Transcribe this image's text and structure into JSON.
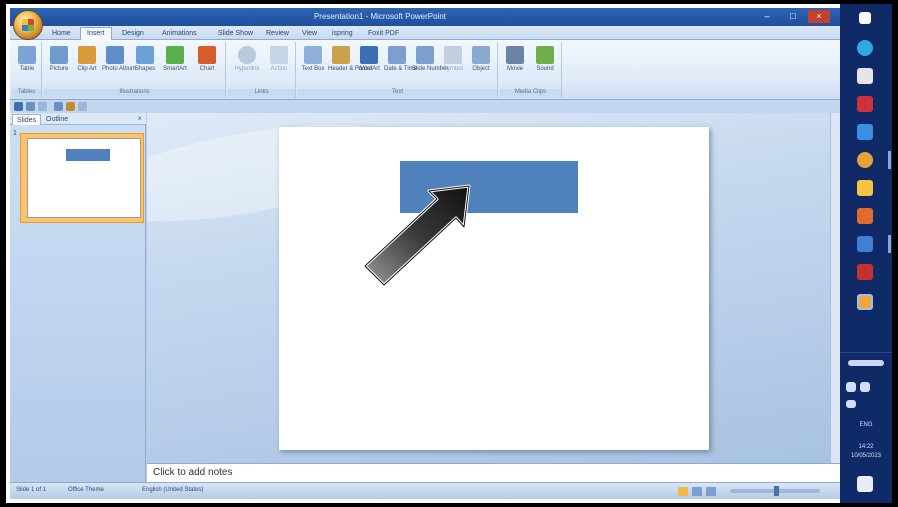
{
  "window": {
    "title": "Presentation1 - Microsoft PowerPoint",
    "minimize": "–",
    "maximize": "□",
    "close": "×"
  },
  "ribbon_tabs": [
    {
      "label": "Home"
    },
    {
      "label": "Insert",
      "active": true
    },
    {
      "label": "Design"
    },
    {
      "label": "Animations"
    },
    {
      "label": "Slide Show"
    },
    {
      "label": "Review"
    },
    {
      "label": "View"
    },
    {
      "label": "ispring"
    },
    {
      "label": "Foxit PDF"
    }
  ],
  "ribbon_groups": {
    "tables": {
      "label": "Tables",
      "buttons": [
        {
          "label": "Table",
          "icon": "table-icon",
          "color": "#7da4d6"
        }
      ]
    },
    "illustrations": {
      "label": "Illustrations",
      "buttons": [
        {
          "label": "Picture",
          "icon": "picture-icon",
          "color": "#6e9ccf"
        },
        {
          "label": "Clip Art",
          "icon": "clip-art-icon",
          "color": "#d89a3a"
        },
        {
          "label": "Photo Album",
          "icon": "photo-album-icon",
          "color": "#5e8fc8"
        },
        {
          "label": "Shapes",
          "icon": "shapes-icon",
          "color": "#6aa2d8"
        },
        {
          "label": "SmartArt",
          "icon": "smartart-icon",
          "color": "#5bb04b"
        },
        {
          "label": "Chart",
          "icon": "chart-icon",
          "color": "#d85b2a"
        }
      ]
    },
    "links": {
      "label": "Links",
      "buttons": [
        {
          "label": "Hyperlink",
          "icon": "hyperlink-icon",
          "color": "#b9c9df"
        },
        {
          "label": "Action",
          "icon": "action-icon",
          "color": "#c6d4e8"
        }
      ]
    },
    "text": {
      "label": "Text",
      "buttons": [
        {
          "label": "Text Box",
          "icon": "text-box-icon",
          "color": "#8fb0da"
        },
        {
          "label": "Header & Footer",
          "icon": "header-footer-icon",
          "color": "#c9a24a"
        },
        {
          "label": "WordArt",
          "icon": "wordart-icon",
          "color": "#3d6fb6"
        },
        {
          "label": "Date & Time",
          "icon": "date-time-icon",
          "color": "#7d9fcf"
        },
        {
          "label": "Slide Number",
          "icon": "slide-number-icon",
          "color": "#7d9fcf"
        },
        {
          "label": "Symbol",
          "icon": "symbol-icon",
          "color": "#c3cfdf"
        },
        {
          "label": "Object",
          "icon": "object-icon",
          "color": "#8aa9d3"
        }
      ]
    },
    "media": {
      "label": "Media Clips",
      "buttons": [
        {
          "label": "Movie",
          "icon": "movie-icon",
          "color": "#6a84a6"
        },
        {
          "label": "Sound",
          "icon": "sound-icon",
          "color": "#6fae4c"
        }
      ]
    }
  },
  "slides_panel": {
    "tab_slides": "Slides",
    "tab_outline": "Outline",
    "close": "×",
    "thumbnail_number": "1"
  },
  "notes": {
    "placeholder": "Click to add notes"
  },
  "status_bar": {
    "slide_info": "Slide 1 of 1",
    "theme": "Office Theme",
    "language": "English (United States)"
  },
  "taskbar": {
    "language": "ENG",
    "time": "14:22",
    "date": "10/05/2023"
  },
  "colors": {
    "shape_fill": "#4f81bd",
    "accent": "#1f4f9d"
  }
}
